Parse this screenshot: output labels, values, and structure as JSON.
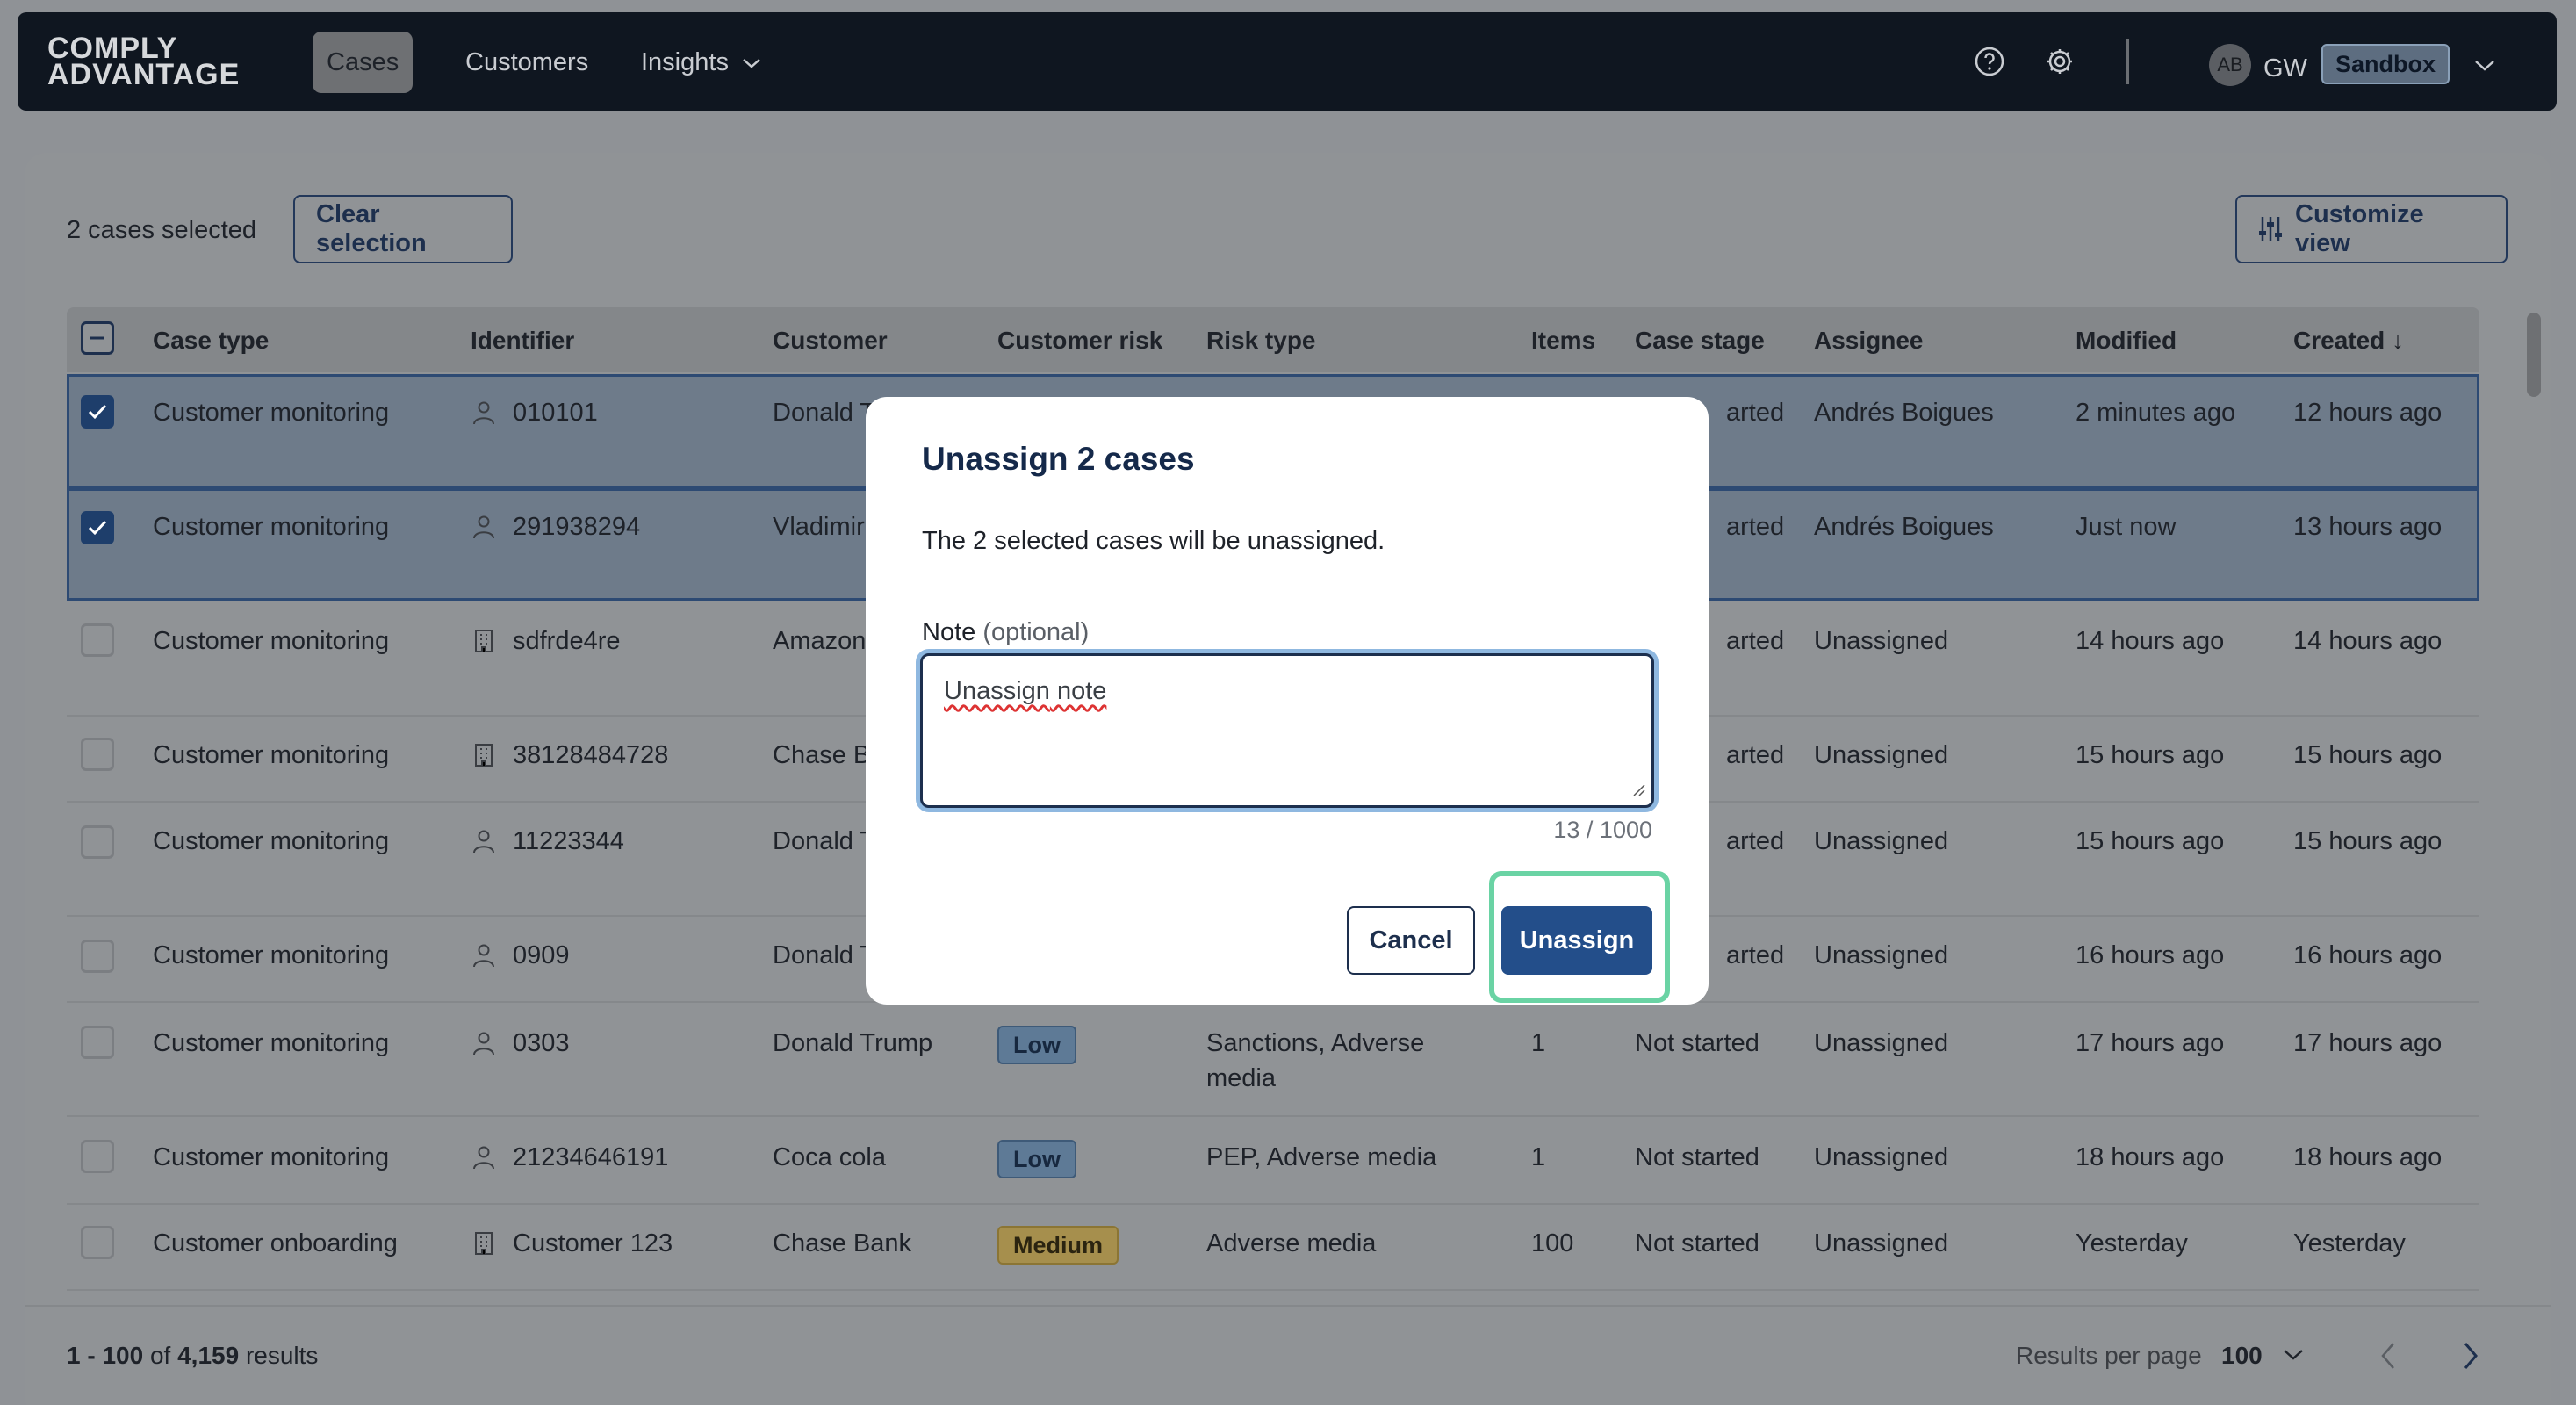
{
  "nav": {
    "logo_line1": "COMPLY",
    "logo_line2": "ADVANTAGE",
    "tabs": [
      {
        "label": "Cases",
        "active": true
      },
      {
        "label": "Customers",
        "active": false
      },
      {
        "label": "Insights",
        "active": false,
        "has_dropdown": true
      }
    ],
    "help_icon": "help-icon",
    "settings_icon": "gear-icon",
    "avatar_initials": "AB",
    "user_initials": "GW",
    "environment": "Sandbox"
  },
  "toolbar": {
    "selection_text": "2 cases selected",
    "clear_selection_label": "Clear selection",
    "customize_view_label": "Customize view"
  },
  "table": {
    "headers": [
      "Case type",
      "Identifier",
      "Customer",
      "Customer risk",
      "Risk type",
      "Items",
      "Case stage",
      "Assignee",
      "Modified",
      "Created ↓"
    ],
    "rows": [
      {
        "selected": true,
        "case_type": "Customer monitoring",
        "id_icon": "person-icon",
        "identifier": "010101",
        "customer": "Donald T",
        "risk": "",
        "risk_type": "",
        "items": "",
        "stage": "arted",
        "assignee": "Andrés Boigues",
        "modified": "2 minutes ago",
        "created": "12 hours ago"
      },
      {
        "selected": true,
        "case_type": "Customer monitoring",
        "id_icon": "person-icon",
        "identifier": "291938294",
        "customer": "Vladimir",
        "risk": "",
        "risk_type": "",
        "items": "",
        "stage": "arted",
        "assignee": "Andrés Boigues",
        "modified": "Just now",
        "created": "13 hours ago"
      },
      {
        "selected": false,
        "case_type": "Customer monitoring",
        "id_icon": "building-icon",
        "identifier": "sdfrde4re",
        "customer": "Amazon",
        "risk": "",
        "risk_type": "",
        "items": "",
        "stage": "arted",
        "assignee": "Unassigned",
        "modified": "14 hours ago",
        "created": "14 hours ago"
      },
      {
        "selected": false,
        "case_type": "Customer monitoring",
        "id_icon": "building-icon",
        "identifier": "38128484728",
        "customer": "Chase B",
        "risk": "",
        "risk_type": "",
        "items": "",
        "stage": "arted",
        "assignee": "Unassigned",
        "modified": "15 hours ago",
        "created": "15 hours ago"
      },
      {
        "selected": false,
        "case_type": "Customer monitoring",
        "id_icon": "person-icon",
        "identifier": "11223344",
        "customer": "Donald T",
        "risk": "",
        "risk_type": "",
        "items": "",
        "stage": "arted",
        "assignee": "Unassigned",
        "modified": "15 hours ago",
        "created": "15 hours ago"
      },
      {
        "selected": false,
        "case_type": "Customer monitoring",
        "id_icon": "person-icon",
        "identifier": "0909",
        "customer": "Donald T",
        "risk": "",
        "risk_type": "",
        "items": "",
        "stage": "arted",
        "assignee": "Unassigned",
        "modified": "16 hours ago",
        "created": "16 hours ago"
      },
      {
        "selected": false,
        "case_type": "Customer monitoring",
        "id_icon": "person-icon",
        "identifier": "0303",
        "customer": "Donald Trump",
        "risk": "Low",
        "risk_type_line1": "Sanctions, Adverse",
        "risk_type_line2": "media",
        "items": "1",
        "stage": "Not started",
        "assignee": "Unassigned",
        "modified": "17 hours ago",
        "created": "17 hours ago"
      },
      {
        "selected": false,
        "case_type": "Customer monitoring",
        "id_icon": "person-icon",
        "identifier": "21234646191",
        "customer": "Coca cola",
        "risk": "Low",
        "risk_type": "PEP, Adverse media",
        "items": "1",
        "stage": "Not started",
        "assignee": "Unassigned",
        "modified": "18 hours ago",
        "created": "18 hours ago"
      },
      {
        "selected": false,
        "case_type": "Customer onboarding",
        "id_icon": "building-icon",
        "identifier": "Customer 123",
        "customer": "Chase Bank",
        "risk": "Medium",
        "risk_type": "Adverse media",
        "items": "100",
        "stage": "Not started",
        "assignee": "Unassigned",
        "modified": "Yesterday",
        "created": "Yesterday"
      }
    ]
  },
  "footer": {
    "range": "1 - 100",
    "of": "of",
    "total": "4,159",
    "results_word": "results",
    "rpp_label": "Results per page",
    "rpp_value": "100"
  },
  "modal": {
    "title": "Unassign 2 cases",
    "description": "The 2 selected cases will be unassigned.",
    "note_label": "Note",
    "note_optional": "(optional)",
    "note_value_word1": "Unassign",
    "note_value_rest": " note",
    "counter": "13 / 1000",
    "cancel_label": "Cancel",
    "confirm_label": "Unassign"
  },
  "colors": {
    "nav_bg": "#0f1620",
    "primary": "#234e8a",
    "focus_ring": "#6ad3a4",
    "badge_low": "#5e7a96",
    "badge_medium": "#a68f4d"
  }
}
